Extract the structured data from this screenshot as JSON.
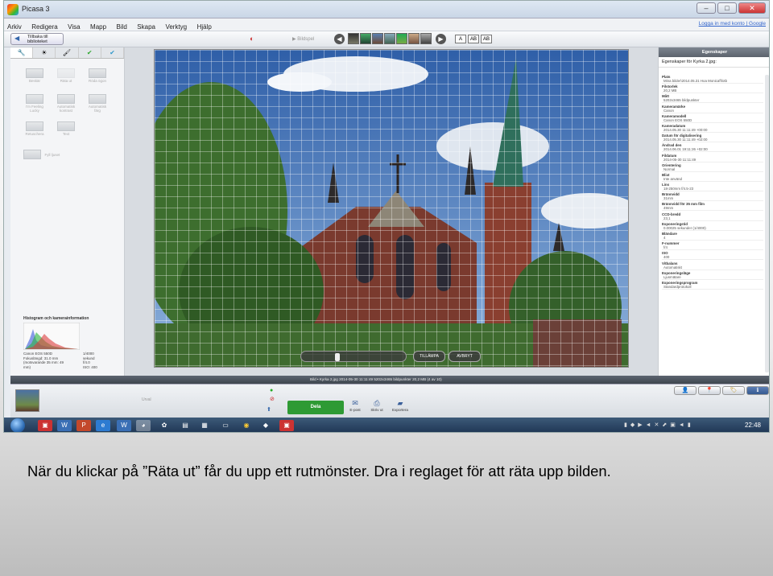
{
  "window": {
    "title": "Picasa 3",
    "controls": [
      "–",
      "□",
      "✕"
    ]
  },
  "menu": {
    "items": [
      "Arkiv",
      "Redigera",
      "Visa",
      "Mapp",
      "Bild",
      "Skapa",
      "Verktyg",
      "Hjälp"
    ],
    "login": "Logga in med konto | Google"
  },
  "toolbar": {
    "back_label": "Tillbaka till biblioteket",
    "play_label": "Bildspel",
    "view_buttons": [
      "A",
      "AB",
      "AB"
    ]
  },
  "left_panel": {
    "tabs": [
      "wrench",
      "sun",
      "brush",
      "check",
      "check-blue"
    ],
    "tools": [
      "Beskär",
      "Räta ut",
      "Röda ögon",
      "I'm Feeling Lucky",
      "Automatisk kontrast",
      "Automatisk färg",
      "Retuschera",
      "Text",
      "Fyll ljuset"
    ],
    "histogram_title": "Histogram och kamerainformation",
    "camera_info_left": "Canon EOS 550D\nFokuslängd: 31.0 mm\n(motsvarande 35 mm: 49\nmm)",
    "camera_info_right": "1/4000\nsekund\nf/4.0\nISO: 400"
  },
  "straighten": {
    "apply_label": "TILLÄMPA",
    "cancel_label": "AVBRYT",
    "slider_value": 0.33
  },
  "right_panel": {
    "title": "Egenskaper",
    "subtitle": "Egenskaper för Kyrka 2.jpg:",
    "properties": [
      {
        "key": "Plats",
        "value": "Mina bilder\\2014.05.31 Hoa Monicaf\\fotb"
      },
      {
        "key": "Filstorlek",
        "value": "20,2 MB"
      },
      {
        "key": "Mått",
        "value": "5202x3465 bildpunkter"
      },
      {
        "key": "Kameramärke",
        "value": "Canon"
      },
      {
        "key": "Kameramodell",
        "value": "Canon EOS 550D"
      },
      {
        "key": "Kameradatum",
        "value": "2014.05.30 11:11:49 +00:00"
      },
      {
        "key": "Datum för digitalisering",
        "value": "2014.05.30 11:11:49 +02:00"
      },
      {
        "key": "Ändrad den",
        "value": "2014.06.01 19:11:26 +02:00"
      },
      {
        "key": "Fildatum",
        "value": "2014-05-30 11:11:49"
      },
      {
        "key": "Orientering",
        "value": "Normal"
      },
      {
        "key": "Blixt",
        "value": "Inte använd"
      },
      {
        "key": "Lins",
        "value": "18-250mm f/4.5-23"
      },
      {
        "key": "Brännvidd",
        "value": "31mm"
      },
      {
        "key": "Brännvidd för 35 mm film",
        "value": "49mm"
      },
      {
        "key": "CCD-bredd",
        "value": "23,1"
      },
      {
        "key": "Exponeringstid",
        "value": "0.00025 sekunder (1/4000)"
      },
      {
        "key": "Bländare",
        "value": "4"
      },
      {
        "key": "F-nummer",
        "value": "f/4"
      },
      {
        "key": "ISO",
        "value": "400"
      },
      {
        "key": "Vitbalans",
        "value": "Automatiskt"
      },
      {
        "key": "Exponeringsläge",
        "value": "Ljusmätare"
      },
      {
        "key": "Exponeringsprogram",
        "value": "Standardprotokoll"
      }
    ]
  },
  "statusbar": {
    "text": "Bild • Kyrka 2.jpg    2014-05-30 11:11:49    5202x3465 bildpunkter    20,2 MB    (4 av 10)"
  },
  "tray": {
    "label": "Urval",
    "share_label": "Dela",
    "actions": [
      "E-post",
      "Skriv ut",
      "Exportera"
    ]
  },
  "taskbar": {
    "time": "22:48"
  },
  "caption": "När du klickar på ”Räta ut” får du upp ett rutmönster. Dra i reglaget för att räta upp bilden."
}
